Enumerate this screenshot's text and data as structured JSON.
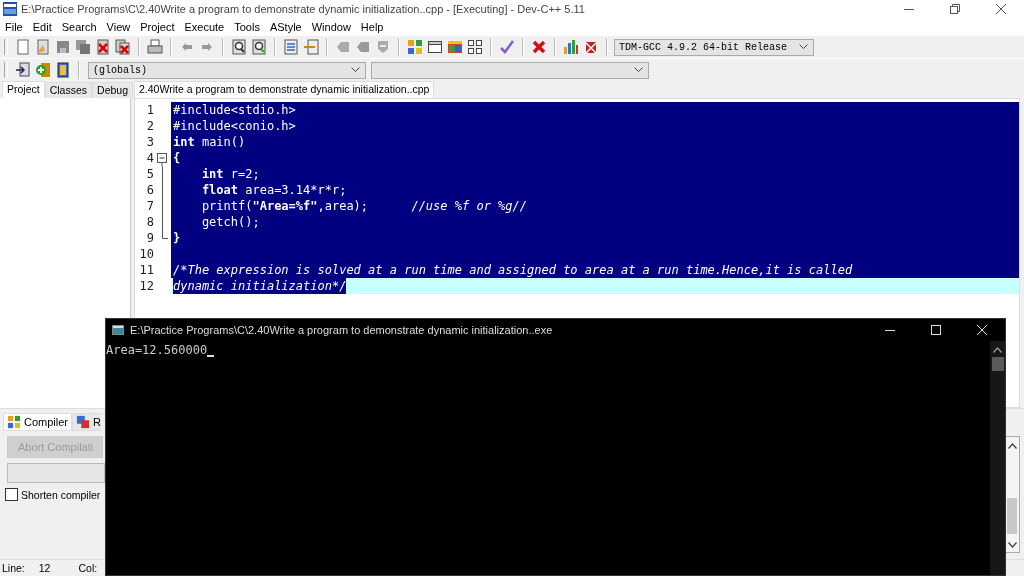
{
  "window": {
    "title": "E:\\Practice Programs\\C\\2.40Write a program to demonstrate dynamic initialization..cpp - [Executing] - Dev-C++ 5.11"
  },
  "menu": [
    "File",
    "Edit",
    "Search",
    "View",
    "Project",
    "Execute",
    "Tools",
    "AStyle",
    "Window",
    "Help"
  ],
  "toolbar": {
    "compiler": "TDM-GCC 4.9.2 64-bit Release",
    "scope": "(globals)"
  },
  "left_tabs": [
    {
      "label": "Project",
      "selected": true
    },
    {
      "label": "Classes",
      "selected": false
    },
    {
      "label": "Debug",
      "selected": false
    }
  ],
  "editor": {
    "tab": {
      "label": "2.40Write a program to demonstrate dynamic initialization..cpp",
      "selected": true
    },
    "lines": [
      {
        "number": "1",
        "selected": true,
        "tokens": [
          {
            "text": "#include<stdio.h>",
            "kind": "plain"
          }
        ]
      },
      {
        "number": "2",
        "selected": true,
        "tokens": [
          {
            "text": "#include<conio.h>",
            "kind": "plain"
          }
        ]
      },
      {
        "number": "3",
        "selected": true,
        "tokens": [
          {
            "text": "int",
            "kind": "keyword"
          },
          {
            "text": " main()",
            "kind": "plain"
          }
        ]
      },
      {
        "number": "4",
        "selected": true,
        "fold_start": true,
        "tokens": [
          {
            "text": "{",
            "kind": "keyword"
          }
        ]
      },
      {
        "number": "5",
        "selected": true,
        "fold_guide": true,
        "indented": true,
        "tokens": [
          {
            "text": "int",
            "kind": "keyword"
          },
          {
            "text": " r=2;",
            "kind": "plain"
          }
        ]
      },
      {
        "number": "6",
        "selected": true,
        "fold_guide": true,
        "indented": true,
        "tokens": [
          {
            "text": "float",
            "kind": "keyword"
          },
          {
            "text": " area=3.14*r*r;",
            "kind": "plain"
          }
        ]
      },
      {
        "number": "7",
        "selected": true,
        "fold_guide": true,
        "indented": true,
        "tokens": [
          {
            "text": "printf(",
            "kind": "plain"
          },
          {
            "text": "\"Area=%f\"",
            "kind": "string"
          },
          {
            "text": ",area);      ",
            "kind": "plain"
          },
          {
            "text": "//use %f or %g//",
            "kind": "comment"
          }
        ]
      },
      {
        "number": "8",
        "selected": true,
        "fold_guide": true,
        "indented": true,
        "tokens": [
          {
            "text": "getch();",
            "kind": "plain"
          }
        ]
      },
      {
        "number": "9",
        "selected": true,
        "fold_end": true,
        "tokens": [
          {
            "text": "}",
            "kind": "keyword"
          }
        ]
      },
      {
        "number": "10",
        "selected": true
      },
      {
        "number": "11",
        "selected": true,
        "tokens": [
          {
            "text": "/*The expression is solved at a run time and assigned to area at a run time.Hence,it is called",
            "kind": "comment"
          }
        ]
      },
      {
        "number": "12",
        "selected": true,
        "current": true,
        "tokens": [
          {
            "text": "dynamic initialization*/",
            "kind": "comment"
          }
        ]
      }
    ]
  },
  "bottom_panel": {
    "tabs": [
      {
        "label": "Compiler",
        "selected": true
      },
      {
        "label": "R",
        "selected": false
      }
    ],
    "abort_button": {
      "label": "Abort Compilati",
      "disabled": true
    },
    "shorten_checkbox": {
      "label": "Shorten compiler",
      "checked": false
    }
  },
  "status_bar": {
    "line_label": "Line:",
    "line": "12",
    "col_label": "Col:"
  },
  "console": {
    "title": "E:\\Practice Programs\\C\\2.40Write a program to demonstrate dynamic initialization..exe",
    "output": "Area=12.560000"
  }
}
